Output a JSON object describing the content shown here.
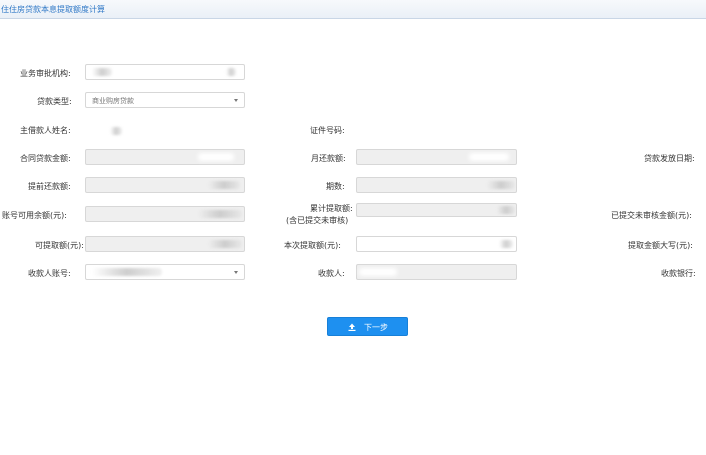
{
  "header": {
    "title": "住住房贷款本息提取额度计算"
  },
  "form": {
    "agency_label": "业务审批机构:",
    "loan_type_label": "贷款类型:",
    "loan_type_value": "商业购房贷款",
    "borrower_name_label": "主借款人姓名:",
    "id_number_label": "证件号码:",
    "contract_amount_label": "合同贷款金额:",
    "monthly_payment_label": "月还款额:",
    "disbursement_date_label": "贷款发放日期:",
    "prepayment_label": "提前还款额:",
    "periods_label": "期数:",
    "account_balance_label": "账号可用余额(元):",
    "cumulative_label_line1": "累计提取额:",
    "cumulative_label_line2": "(含已提交未审核)",
    "pending_amount_label": "已提交未审核金额(元):",
    "withdrawable_label": "可提取额(元):",
    "current_withdrawal_label": "本次提取额(元):",
    "amount_uppercase_label": "提取金额大写(元):",
    "payee_account_label": "收款人账号:",
    "payee_label": "收款人:",
    "payee_bank_label": "收款银行:"
  },
  "actions": {
    "next_label": "下一步"
  },
  "colors": {
    "accent": "#1e90f0",
    "title": "#2e77c6"
  }
}
